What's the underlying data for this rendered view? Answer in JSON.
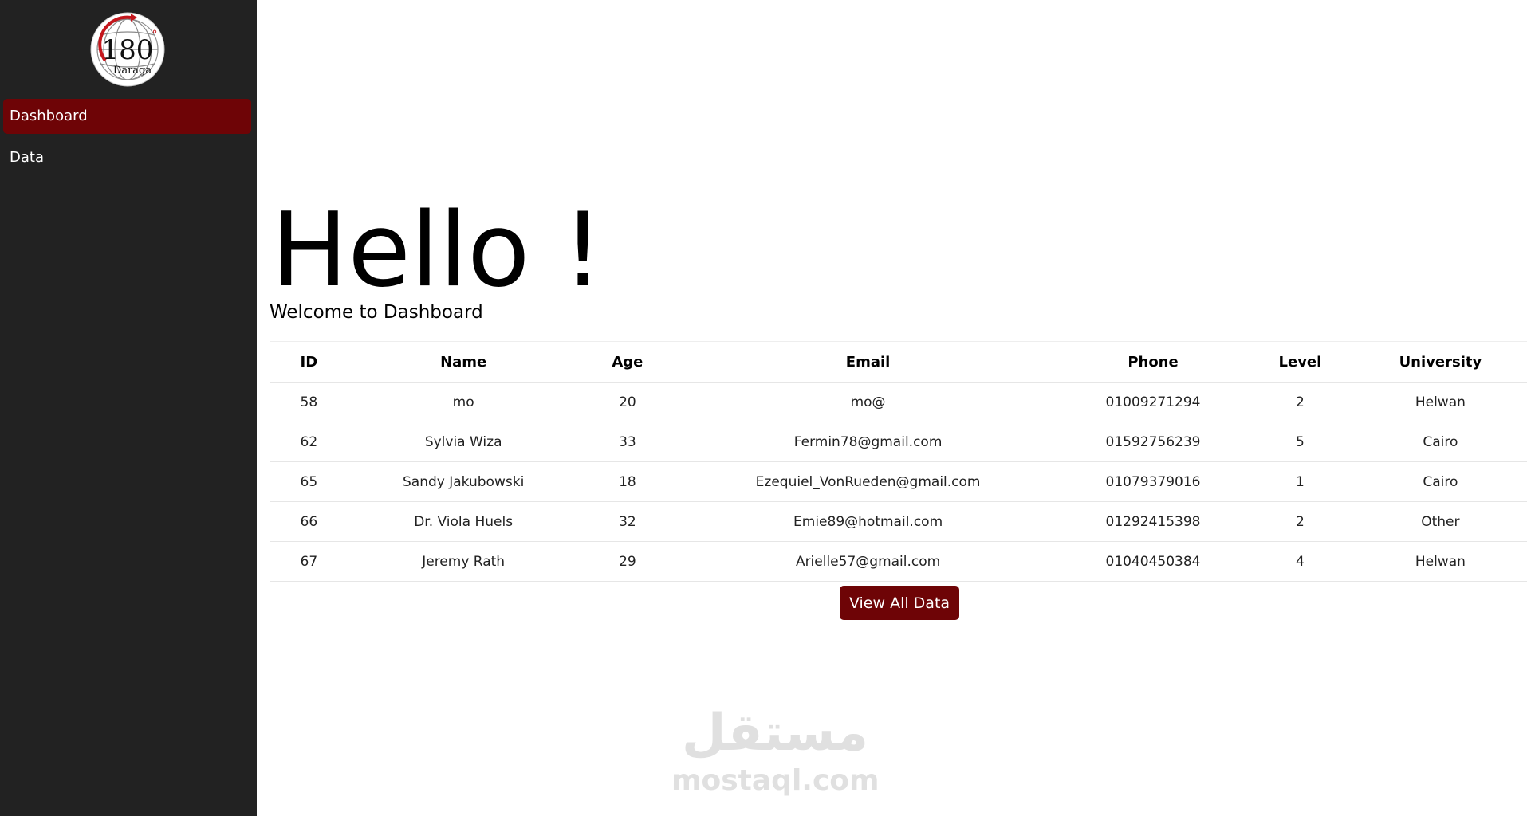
{
  "logo": {
    "number": "180",
    "degree_mark": "°",
    "subtitle": "Daraga"
  },
  "sidebar": {
    "items": [
      {
        "label": "Dashboard",
        "active": true
      },
      {
        "label": "Data",
        "active": false
      }
    ]
  },
  "main": {
    "greeting": "Hello !",
    "subtitle": "Welcome to Dashboard"
  },
  "table": {
    "headers": [
      "ID",
      "Name",
      "Age",
      "Email",
      "Phone",
      "Level",
      "University"
    ],
    "rows": [
      [
        "58",
        "mo",
        "20",
        "mo@",
        "01009271294",
        "2",
        "Helwan"
      ],
      [
        "62",
        "Sylvia Wiza",
        "33",
        "Fermin78@gmail.com",
        "01592756239",
        "5",
        "Cairo"
      ],
      [
        "65",
        "Sandy Jakubowski",
        "18",
        "Ezequiel_VonRueden@gmail.com",
        "01079379016",
        "1",
        "Cairo"
      ],
      [
        "66",
        "Dr. Viola Huels",
        "32",
        "Emie89@hotmail.com",
        "01292415398",
        "2",
        "Other"
      ],
      [
        "67",
        "Jeremy Rath",
        "29",
        "Arielle57@gmail.com",
        "01040450384",
        "4",
        "Helwan"
      ]
    ]
  },
  "actions": {
    "view_all_label": "View All Data"
  },
  "watermark": {
    "arabic": "مستقل",
    "latin": "mostaql.com"
  },
  "colors": {
    "sidebar_bg": "#222222",
    "accent": "#6e0406",
    "logo_red": "#c4161c"
  }
}
